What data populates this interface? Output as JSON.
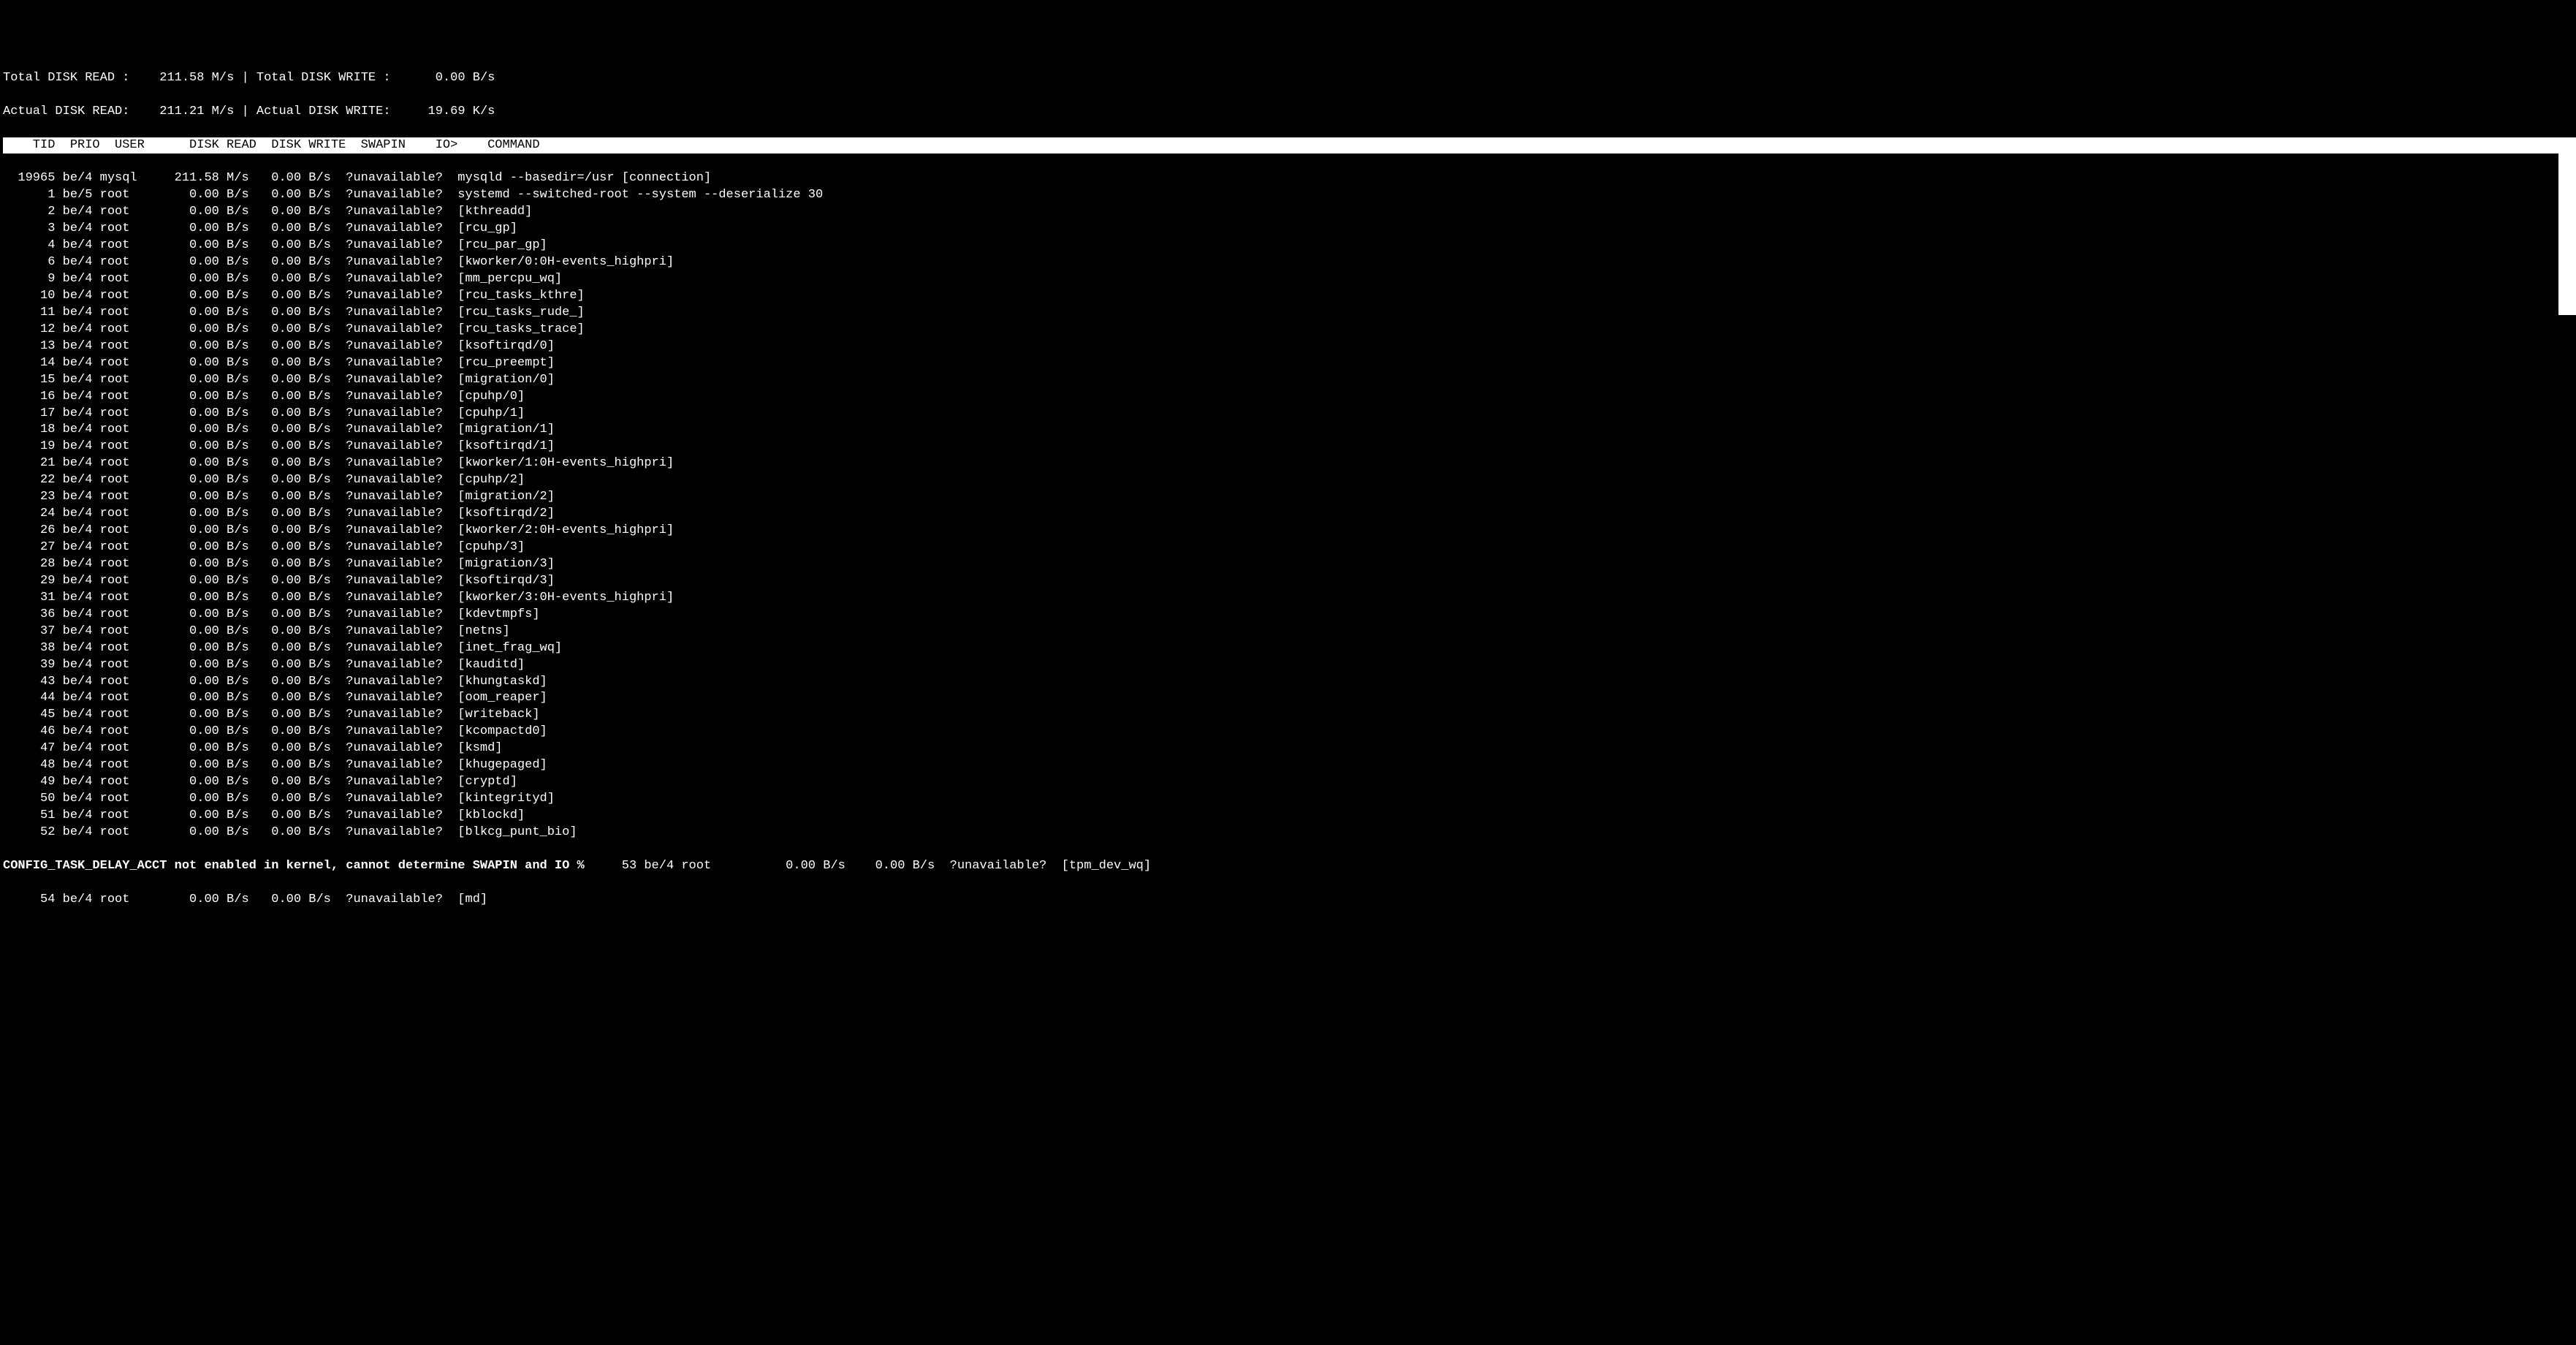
{
  "summary": {
    "total_read_label": "Total DISK READ :",
    "total_read_value": "211.58 M/s",
    "sep1": " | ",
    "total_write_label": "Total DISK WRITE :",
    "total_write_value": "0.00 B/s",
    "actual_read_label": "Actual DISK READ:",
    "actual_read_value": "211.21 M/s",
    "sep2": " | ",
    "actual_write_label": "Actual DISK WRITE:",
    "actual_write_value": "19.69 K/s"
  },
  "header": {
    "tid": "TID",
    "prio": "PRIO",
    "user": "USER",
    "disk_read": "DISK READ",
    "disk_write": "DISK WRITE",
    "swapin": "SWAPIN",
    "io": "IO>",
    "command": "COMMAND"
  },
  "rows": [
    {
      "tid": "19965",
      "prio": "be/4",
      "user": "mysql",
      "read": "211.58 M/s",
      "write": "0.00 B/s",
      "swapin": "?unavailable?",
      "cmd": "mysqld --basedir=/usr [connection]"
    },
    {
      "tid": "1",
      "prio": "be/5",
      "user": "root",
      "read": "0.00 B/s",
      "write": "0.00 B/s",
      "swapin": "?unavailable?",
      "cmd": "systemd --switched-root --system --deserialize 30"
    },
    {
      "tid": "2",
      "prio": "be/4",
      "user": "root",
      "read": "0.00 B/s",
      "write": "0.00 B/s",
      "swapin": "?unavailable?",
      "cmd": "[kthreadd]"
    },
    {
      "tid": "3",
      "prio": "be/4",
      "user": "root",
      "read": "0.00 B/s",
      "write": "0.00 B/s",
      "swapin": "?unavailable?",
      "cmd": "[rcu_gp]"
    },
    {
      "tid": "4",
      "prio": "be/4",
      "user": "root",
      "read": "0.00 B/s",
      "write": "0.00 B/s",
      "swapin": "?unavailable?",
      "cmd": "[rcu_par_gp]"
    },
    {
      "tid": "6",
      "prio": "be/4",
      "user": "root",
      "read": "0.00 B/s",
      "write": "0.00 B/s",
      "swapin": "?unavailable?",
      "cmd": "[kworker/0:0H-events_highpri]"
    },
    {
      "tid": "9",
      "prio": "be/4",
      "user": "root",
      "read": "0.00 B/s",
      "write": "0.00 B/s",
      "swapin": "?unavailable?",
      "cmd": "[mm_percpu_wq]"
    },
    {
      "tid": "10",
      "prio": "be/4",
      "user": "root",
      "read": "0.00 B/s",
      "write": "0.00 B/s",
      "swapin": "?unavailable?",
      "cmd": "[rcu_tasks_kthre]"
    },
    {
      "tid": "11",
      "prio": "be/4",
      "user": "root",
      "read": "0.00 B/s",
      "write": "0.00 B/s",
      "swapin": "?unavailable?",
      "cmd": "[rcu_tasks_rude_]"
    },
    {
      "tid": "12",
      "prio": "be/4",
      "user": "root",
      "read": "0.00 B/s",
      "write": "0.00 B/s",
      "swapin": "?unavailable?",
      "cmd": "[rcu_tasks_trace]"
    },
    {
      "tid": "13",
      "prio": "be/4",
      "user": "root",
      "read": "0.00 B/s",
      "write": "0.00 B/s",
      "swapin": "?unavailable?",
      "cmd": "[ksoftirqd/0]"
    },
    {
      "tid": "14",
      "prio": "be/4",
      "user": "root",
      "read": "0.00 B/s",
      "write": "0.00 B/s",
      "swapin": "?unavailable?",
      "cmd": "[rcu_preempt]"
    },
    {
      "tid": "15",
      "prio": "be/4",
      "user": "root",
      "read": "0.00 B/s",
      "write": "0.00 B/s",
      "swapin": "?unavailable?",
      "cmd": "[migration/0]"
    },
    {
      "tid": "16",
      "prio": "be/4",
      "user": "root",
      "read": "0.00 B/s",
      "write": "0.00 B/s",
      "swapin": "?unavailable?",
      "cmd": "[cpuhp/0]"
    },
    {
      "tid": "17",
      "prio": "be/4",
      "user": "root",
      "read": "0.00 B/s",
      "write": "0.00 B/s",
      "swapin": "?unavailable?",
      "cmd": "[cpuhp/1]"
    },
    {
      "tid": "18",
      "prio": "be/4",
      "user": "root",
      "read": "0.00 B/s",
      "write": "0.00 B/s",
      "swapin": "?unavailable?",
      "cmd": "[migration/1]"
    },
    {
      "tid": "19",
      "prio": "be/4",
      "user": "root",
      "read": "0.00 B/s",
      "write": "0.00 B/s",
      "swapin": "?unavailable?",
      "cmd": "[ksoftirqd/1]"
    },
    {
      "tid": "21",
      "prio": "be/4",
      "user": "root",
      "read": "0.00 B/s",
      "write": "0.00 B/s",
      "swapin": "?unavailable?",
      "cmd": "[kworker/1:0H-events_highpri]"
    },
    {
      "tid": "22",
      "prio": "be/4",
      "user": "root",
      "read": "0.00 B/s",
      "write": "0.00 B/s",
      "swapin": "?unavailable?",
      "cmd": "[cpuhp/2]"
    },
    {
      "tid": "23",
      "prio": "be/4",
      "user": "root",
      "read": "0.00 B/s",
      "write": "0.00 B/s",
      "swapin": "?unavailable?",
      "cmd": "[migration/2]"
    },
    {
      "tid": "24",
      "prio": "be/4",
      "user": "root",
      "read": "0.00 B/s",
      "write": "0.00 B/s",
      "swapin": "?unavailable?",
      "cmd": "[ksoftirqd/2]"
    },
    {
      "tid": "26",
      "prio": "be/4",
      "user": "root",
      "read": "0.00 B/s",
      "write": "0.00 B/s",
      "swapin": "?unavailable?",
      "cmd": "[kworker/2:0H-events_highpri]"
    },
    {
      "tid": "27",
      "prio": "be/4",
      "user": "root",
      "read": "0.00 B/s",
      "write": "0.00 B/s",
      "swapin": "?unavailable?",
      "cmd": "[cpuhp/3]"
    },
    {
      "tid": "28",
      "prio": "be/4",
      "user": "root",
      "read": "0.00 B/s",
      "write": "0.00 B/s",
      "swapin": "?unavailable?",
      "cmd": "[migration/3]"
    },
    {
      "tid": "29",
      "prio": "be/4",
      "user": "root",
      "read": "0.00 B/s",
      "write": "0.00 B/s",
      "swapin": "?unavailable?",
      "cmd": "[ksoftirqd/3]"
    },
    {
      "tid": "31",
      "prio": "be/4",
      "user": "root",
      "read": "0.00 B/s",
      "write": "0.00 B/s",
      "swapin": "?unavailable?",
      "cmd": "[kworker/3:0H-events_highpri]"
    },
    {
      "tid": "36",
      "prio": "be/4",
      "user": "root",
      "read": "0.00 B/s",
      "write": "0.00 B/s",
      "swapin": "?unavailable?",
      "cmd": "[kdevtmpfs]"
    },
    {
      "tid": "37",
      "prio": "be/4",
      "user": "root",
      "read": "0.00 B/s",
      "write": "0.00 B/s",
      "swapin": "?unavailable?",
      "cmd": "[netns]"
    },
    {
      "tid": "38",
      "prio": "be/4",
      "user": "root",
      "read": "0.00 B/s",
      "write": "0.00 B/s",
      "swapin": "?unavailable?",
      "cmd": "[inet_frag_wq]"
    },
    {
      "tid": "39",
      "prio": "be/4",
      "user": "root",
      "read": "0.00 B/s",
      "write": "0.00 B/s",
      "swapin": "?unavailable?",
      "cmd": "[kauditd]"
    },
    {
      "tid": "43",
      "prio": "be/4",
      "user": "root",
      "read": "0.00 B/s",
      "write": "0.00 B/s",
      "swapin": "?unavailable?",
      "cmd": "[khungtaskd]"
    },
    {
      "tid": "44",
      "prio": "be/4",
      "user": "root",
      "read": "0.00 B/s",
      "write": "0.00 B/s",
      "swapin": "?unavailable?",
      "cmd": "[oom_reaper]"
    },
    {
      "tid": "45",
      "prio": "be/4",
      "user": "root",
      "read": "0.00 B/s",
      "write": "0.00 B/s",
      "swapin": "?unavailable?",
      "cmd": "[writeback]"
    },
    {
      "tid": "46",
      "prio": "be/4",
      "user": "root",
      "read": "0.00 B/s",
      "write": "0.00 B/s",
      "swapin": "?unavailable?",
      "cmd": "[kcompactd0]"
    },
    {
      "tid": "47",
      "prio": "be/4",
      "user": "root",
      "read": "0.00 B/s",
      "write": "0.00 B/s",
      "swapin": "?unavailable?",
      "cmd": "[ksmd]"
    },
    {
      "tid": "48",
      "prio": "be/4",
      "user": "root",
      "read": "0.00 B/s",
      "write": "0.00 B/s",
      "swapin": "?unavailable?",
      "cmd": "[khugepaged]"
    },
    {
      "tid": "49",
      "prio": "be/4",
      "user": "root",
      "read": "0.00 B/s",
      "write": "0.00 B/s",
      "swapin": "?unavailable?",
      "cmd": "[cryptd]"
    },
    {
      "tid": "50",
      "prio": "be/4",
      "user": "root",
      "read": "0.00 B/s",
      "write": "0.00 B/s",
      "swapin": "?unavailable?",
      "cmd": "[kintegrityd]"
    },
    {
      "tid": "51",
      "prio": "be/4",
      "user": "root",
      "read": "0.00 B/s",
      "write": "0.00 B/s",
      "swapin": "?unavailable?",
      "cmd": "[kblockd]"
    },
    {
      "tid": "52",
      "prio": "be/4",
      "user": "root",
      "read": "0.00 B/s",
      "write": "0.00 B/s",
      "swapin": "?unavailable?",
      "cmd": "[blkcg_punt_bio]"
    }
  ],
  "footer": {
    "msg": "CONFIG_TASK_DELAY_ACCT not enabled in kernel, cannot determine SWAPIN and IO %",
    "extra_row": {
      "tid": "53",
      "prio": "be/4",
      "user": "root",
      "read": "0.00 B/s",
      "write": "0.00 B/s",
      "swapin": "?unavailable?",
      "cmd": "[tpm_dev_wq]"
    }
  },
  "last_row": {
    "tid": "54",
    "prio": "be/4",
    "user": "root",
    "read": "0.00 B/s",
    "write": "0.00 B/s",
    "swapin": "?unavailable?",
    "cmd": "[md]"
  }
}
